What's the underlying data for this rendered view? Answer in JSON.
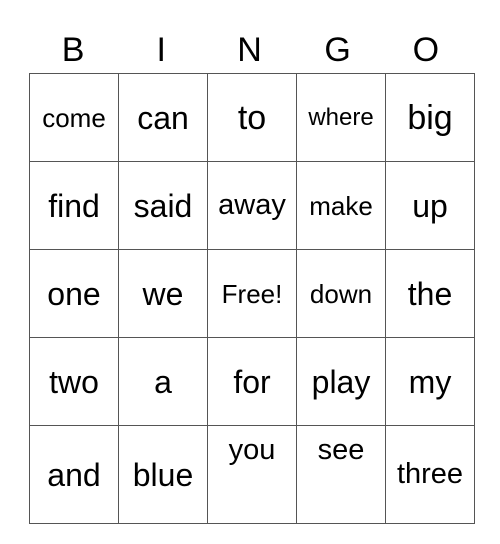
{
  "header": {
    "letters": [
      "B",
      "I",
      "N",
      "G",
      "O"
    ]
  },
  "rows": [
    [
      "come",
      "can",
      "to",
      "where",
      "big"
    ],
    [
      "find",
      "said",
      "away",
      "make",
      "up"
    ],
    [
      "one",
      "we",
      "Free!",
      "down",
      "the"
    ],
    [
      "two",
      "a",
      "for",
      "play",
      "my"
    ],
    [
      "and",
      "blue",
      "you",
      "see",
      "three"
    ]
  ]
}
